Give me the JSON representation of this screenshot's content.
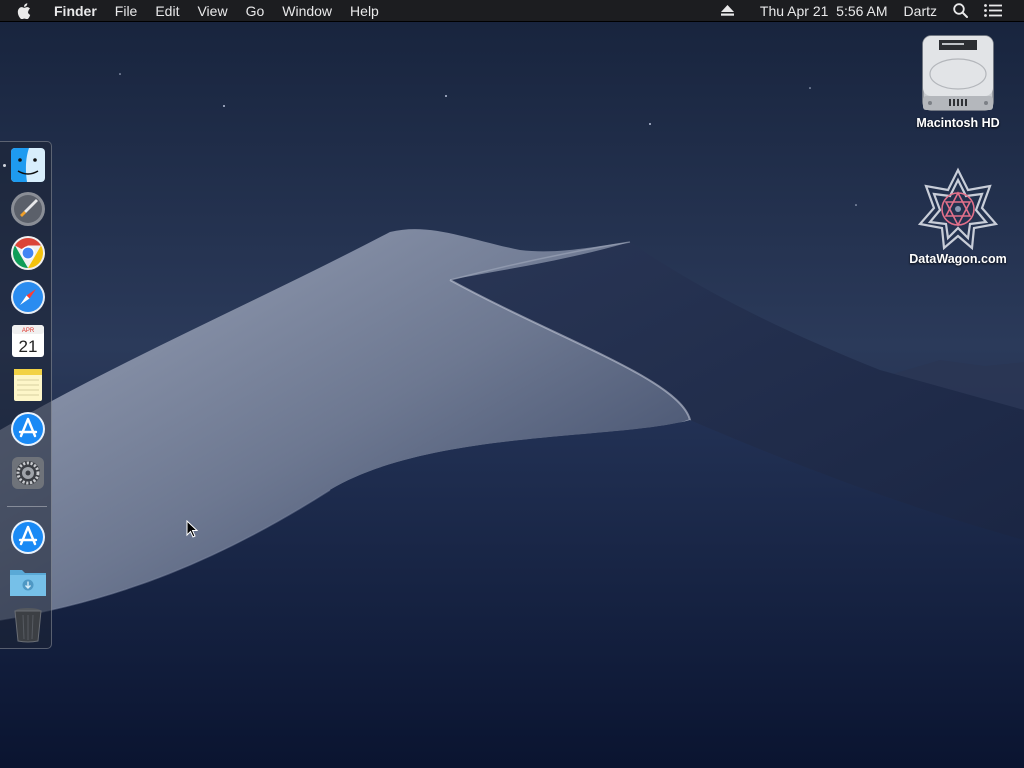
{
  "menubar": {
    "apple_icon": "apple-logo-icon",
    "app_name": "Finder",
    "menus": [
      "File",
      "Edit",
      "View",
      "Go",
      "Window",
      "Help"
    ],
    "eject_icon": "eject-icon",
    "clock": "Thu Apr 21  5:56 AM",
    "user": "Dartz",
    "spotlight_icon": "magnifier-icon",
    "notification_icon": "list-icon"
  },
  "dock": {
    "apps": [
      {
        "name": "Finder",
        "icon": "finder-face-icon",
        "running": true
      },
      {
        "name": "Launchpad",
        "icon": "rocket-icon",
        "running": false
      },
      {
        "name": "Google Chrome",
        "icon": "chrome-icon",
        "running": false
      },
      {
        "name": "Safari",
        "icon": "compass-icon",
        "running": false
      },
      {
        "name": "Calendar",
        "icon": "calendar-icon",
        "month": "APR",
        "day": "21",
        "running": false
      },
      {
        "name": "Notes",
        "icon": "notepad-icon",
        "running": false
      },
      {
        "name": "App Store",
        "icon": "appstore-icon",
        "running": false
      },
      {
        "name": "System Preferences",
        "icon": "gear-icon",
        "running": false
      }
    ],
    "others": [
      {
        "name": "App Store Download",
        "icon": "appstore-icon"
      },
      {
        "name": "Downloads",
        "icon": "download-folder-icon"
      },
      {
        "name": "Trash",
        "icon": "trash-icon"
      }
    ]
  },
  "desktop": {
    "icons": [
      {
        "label": "Macintosh HD",
        "icon": "hard-drive-icon"
      },
      {
        "label": "DataWagon.com",
        "icon": "star-emblem-icon"
      }
    ]
  },
  "colors": {
    "sky_top": "#17243f",
    "sky_bottom": "#0c1630",
    "dune_light": "#8c95ab",
    "dune_dark": "#1b2744"
  }
}
